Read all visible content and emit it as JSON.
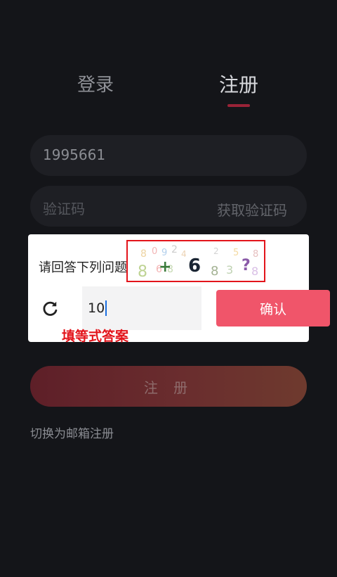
{
  "tabs": {
    "login": "登录",
    "register": "注册"
  },
  "form": {
    "phone_value": "1995661",
    "code_placeholder": "验证码",
    "get_code_label": "获取验证码",
    "register_label": "注 册",
    "switch_label": "切换为邮箱注册"
  },
  "captcha_modal": {
    "question_label": "请回答下列问题",
    "captcha_main_digit": "6",
    "captcha_operator": "+",
    "captcha_end": "?",
    "answer_value": "10",
    "confirm_label": "确认",
    "hint_text": "填等式答案"
  },
  "colors": {
    "background": "#141519",
    "accent": "#9a2337",
    "confirm": "#f0556a",
    "hint": "#e3141b"
  }
}
